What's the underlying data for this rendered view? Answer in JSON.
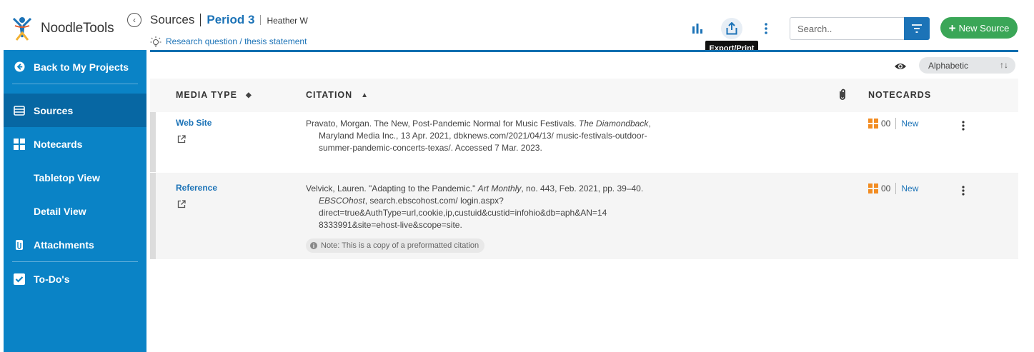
{
  "logo": {
    "text": "NoodleTools"
  },
  "sidebar": {
    "back": "Back to My Projects",
    "items": [
      {
        "label": "Sources"
      },
      {
        "label": "Notecards"
      },
      {
        "label": "Tabletop View"
      },
      {
        "label": "Detail View"
      },
      {
        "label": "Attachments"
      },
      {
        "label": "To-Do's"
      }
    ]
  },
  "header": {
    "section": "Sources",
    "project": "Period 3",
    "user": "Heather W",
    "thesis_link": "Research question / thesis statement",
    "tooltip": "Export/Print",
    "search_placeholder": "Search..",
    "new_source": "New Source"
  },
  "toolbar": {
    "sort_value": "Alphabetic",
    "sort_arrows": "↑↓"
  },
  "colors": {
    "sidebar": "#0a83c6",
    "sidebar_active": "#0767a3",
    "link": "#1c73b7",
    "new_button": "#3aa657",
    "notecard_icon": "#f28c22"
  },
  "table": {
    "headers": {
      "media_type": "MEDIA TYPE",
      "citation": "CITATION",
      "notecards": "NOTECARDS"
    },
    "rows": [
      {
        "media_type": "Web Site",
        "cit_a": "Pravato, Morgan. The New, Post-Pandemic Normal for Music Festivals. ",
        "cit_b": "The Diamondback",
        "cit_c": ", Maryland Media Inc., 13 Apr. 2021, dbknews.com/2021/04/13/ music-festivals-outdoor-summer-pandemic-concerts-texas/. Accessed 7 Mar. 2023.",
        "notecards_count": "00",
        "new_label": "New"
      },
      {
        "media_type": "Reference",
        "cit_a": "Velvick, Lauren. \"Adapting to the Pandemic.\" ",
        "cit_b": "Art Monthly",
        "cit_c": ", no. 443, Feb. 2021, pp. 39–40. ",
        "cit_d": "EBSCOhost",
        "cit_e": ", search.ebscohost.com/ login.aspx?direct=true&AuthType=url,cookie,ip,custuid&custid=infohio&db=aph&AN=14 8333991&site=ehost-live&scope=site.",
        "note": "Note: This is a copy of a preformatted citation",
        "notecards_count": "00",
        "new_label": "New"
      }
    ]
  }
}
